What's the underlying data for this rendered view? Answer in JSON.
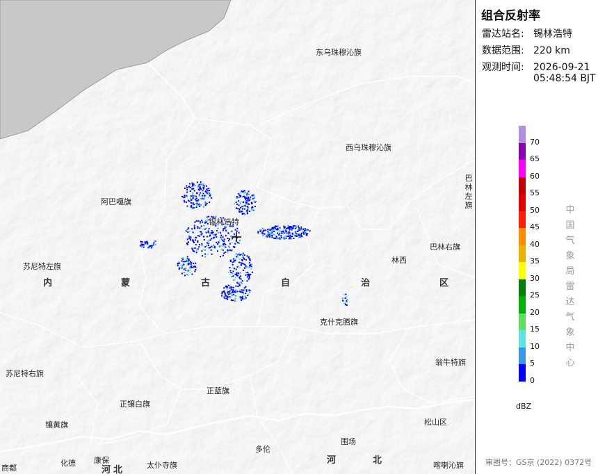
{
  "panel": {
    "title": "组合反射率",
    "station_label": "雷达站名:",
    "station_value": "锡林浩特",
    "range_label": "数据范围:",
    "range_value": "220 km",
    "time_label": "观测时间:",
    "time_value_date": "2026-09-21",
    "time_value_time": "05:48:54 BJT",
    "vertical_credit": "中国气象局雷达气象中心",
    "footer": "审图号：GS京 (2022) 0372号"
  },
  "legend": {
    "unit": "dBZ",
    "ticks": [
      "70",
      "65",
      "60",
      "55",
      "50",
      "45",
      "40",
      "35",
      "30",
      "25",
      "20",
      "15",
      "10",
      "5",
      "0"
    ],
    "colors": [
      "#b48ede",
      "#8b00b0",
      "#ff00ff",
      "#c00000",
      "#e00000",
      "#ff2000",
      "#ff8c00",
      "#e6b400",
      "#ffff00",
      "#008000",
      "#00b000",
      "#5ee05e",
      "#5ae6e6",
      "#3a96e6",
      "#0000ff"
    ]
  },
  "places": {
    "dongwu": "东乌珠穆沁旗",
    "xiwu": "西乌珠穆沁旗",
    "abaga": "阿巴嘎旗",
    "xilinhaote": "锡林浩特",
    "sunite_left": "苏尼特左旗",
    "sunite_right": "苏尼特右旗",
    "linxi": "林西",
    "balin_right": "巴林右旗",
    "balin_left": "巴林左旗",
    "keshiketeng": "克什克腾旗",
    "wengniute": "翁牛特旗",
    "zhenglan": "正蓝旗",
    "zhengxiangbai": "正镶白旗",
    "xianghuang": "镶黄旗",
    "duolun": "多伦",
    "weichang": "围场",
    "songshan": "松山区",
    "kalaqin": "喀喇沁旗",
    "huade": "化德",
    "kangbao": "康保",
    "taipusi": "太仆寺旗",
    "shangdu": "商都",
    "prov_nei": "内",
    "prov_meng": "蒙",
    "prov_gu": "古",
    "prov_zi": "自",
    "prov_zhi": "治",
    "prov_qu": "区",
    "prov_he": "河",
    "prov_bei": "北",
    "prov_he2": "河",
    "prov_bei2": "北"
  }
}
